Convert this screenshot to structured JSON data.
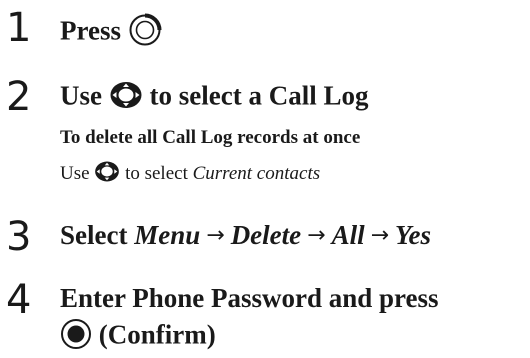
{
  "steps": [
    {
      "number": "1",
      "text": "Press",
      "icon": "side-key-icon"
    },
    {
      "number": "2",
      "before": "Use",
      "icon": "nav-key-icon",
      "after": "to select a Call Log"
    },
    {
      "number": "3",
      "prefix": "Select",
      "items": [
        "Menu",
        "Delete",
        "All",
        "Yes"
      ],
      "separator": "→"
    },
    {
      "number": "4",
      "line1": "Enter Phone Password and press",
      "icon": "center-key-icon",
      "line2": "(Confirm)"
    }
  ],
  "note": {
    "title": "To delete all Call Log records at once",
    "before": "Use",
    "icon": "nav-key-icon",
    "after": "to select",
    "italic": "Current contacts"
  }
}
